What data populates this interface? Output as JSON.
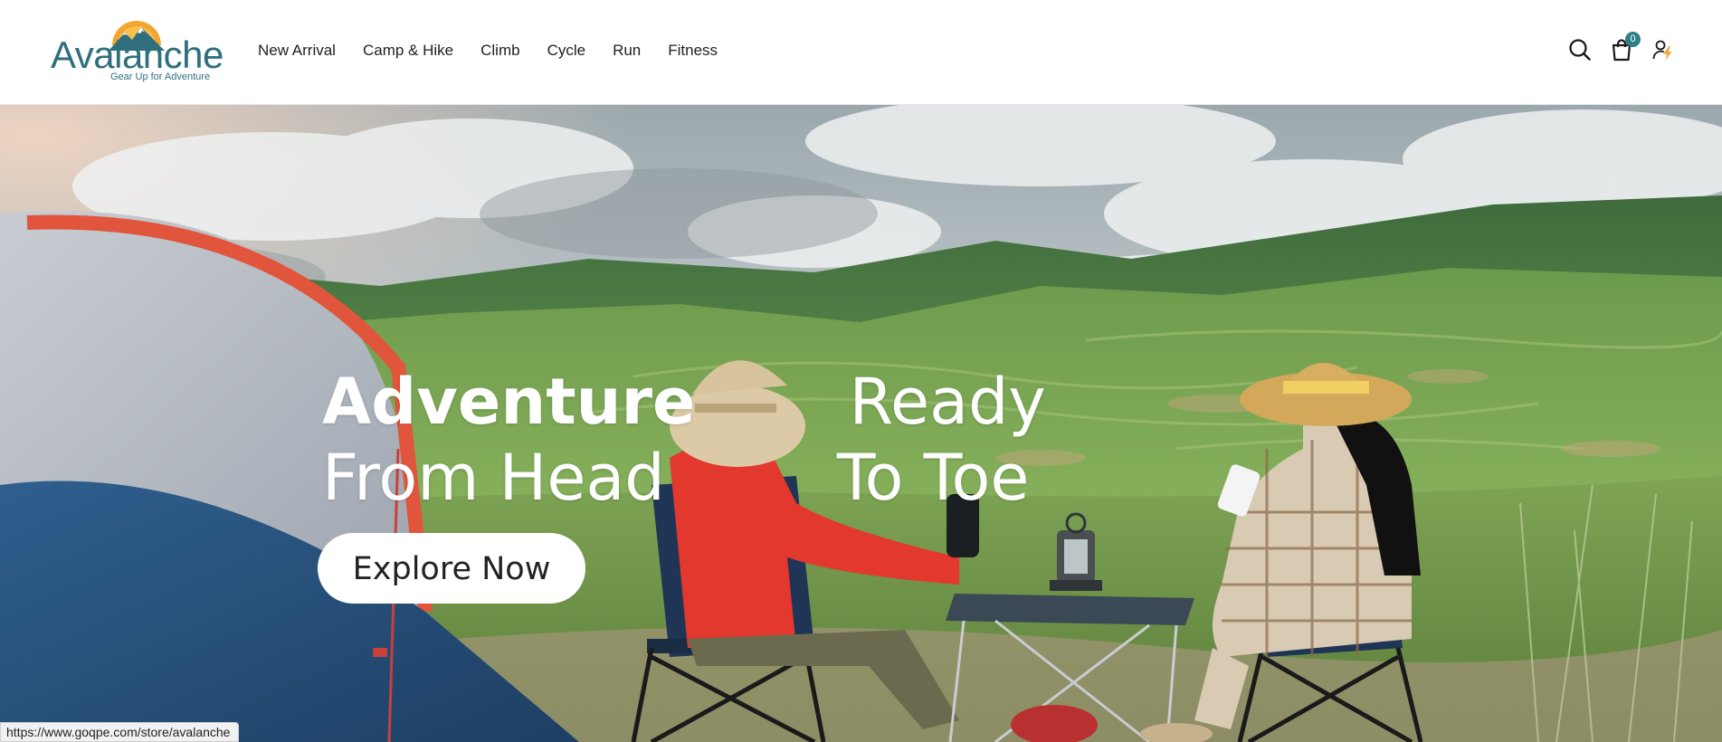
{
  "brand": {
    "name": "Avalanche",
    "tagline": "Gear Up for Adventure",
    "primary_color": "#2f6f7d",
    "accent_color": "#f2a531"
  },
  "nav": {
    "items": [
      {
        "label": "New Arrival"
      },
      {
        "label": "Camp & Hike"
      },
      {
        "label": "Climb"
      },
      {
        "label": "Cycle"
      },
      {
        "label": "Run"
      },
      {
        "label": "Fitness"
      }
    ]
  },
  "header_icons": {
    "search": "search-icon",
    "cart": "shopping-bag-icon",
    "cart_count": "0",
    "account": "user-lightning-icon"
  },
  "hero": {
    "headline_line1_word1": "Adventure",
    "headline_line1_word2": "Ready",
    "headline_line2_word1": "From Head",
    "headline_line2_word2": "To Toe",
    "cta_label": "Explore Now",
    "image_subject": "two campers in chairs overlooking green mountains beside a tent"
  },
  "status_bar": {
    "url": "https://www.goqpe.com/store/avalanche"
  }
}
